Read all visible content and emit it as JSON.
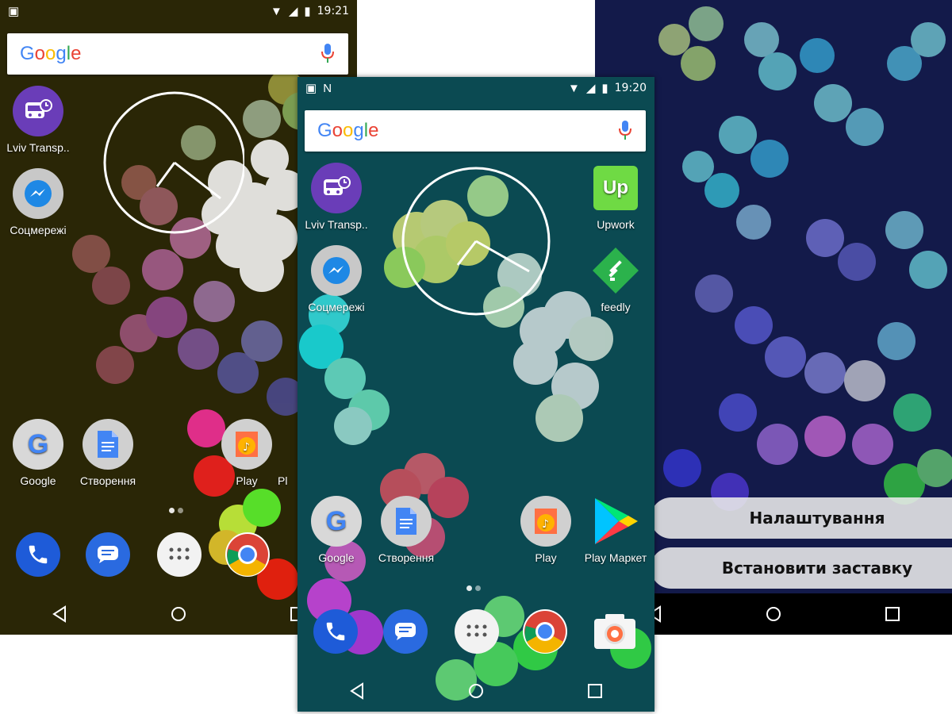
{
  "screens": {
    "left": {
      "time": "19:21",
      "search_logo": "Google",
      "apps": {
        "transport": "Lviv Transp..",
        "social": "Соцмережі",
        "google": "Google",
        "create": "Створення",
        "play": "Play",
        "play2": "Pl"
      }
    },
    "center": {
      "time": "19:20",
      "search_logo": "Google",
      "apps": {
        "transport": "Lviv Transp..",
        "upwork": "Upwork",
        "social": "Соцмережі",
        "feedly": "feedly",
        "google": "Google",
        "create": "Створення",
        "play": "Play",
        "play_market": "Play Маркет"
      }
    },
    "right": {
      "settings_button": "Налаштування",
      "set_wallpaper_button": "Встановити заставку"
    }
  },
  "icons": {
    "upwork_text": "Up"
  },
  "colors": {
    "left_bg": "#2a2606",
    "center_bg": "#0b4a52",
    "right_bg": "#131a4a"
  }
}
